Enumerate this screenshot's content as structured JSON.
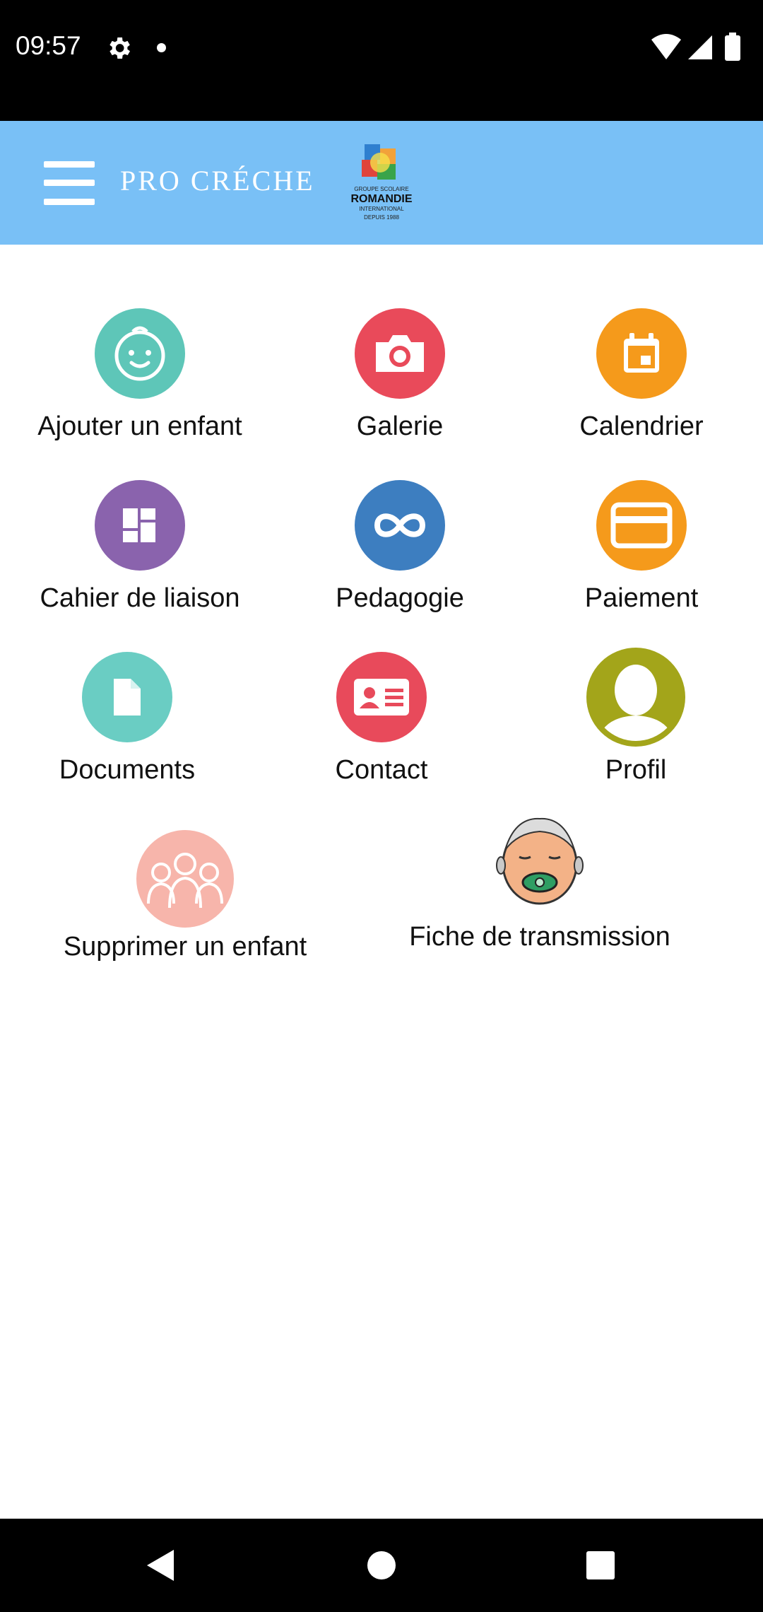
{
  "status_bar": {
    "time": "09:57"
  },
  "app_bar": {
    "title": "PRO CRÉCHE",
    "logo_text": {
      "line1": "GROUPE SCOLAIRE",
      "line2": "ROMANDIE",
      "line3": "INTERNATIONAL",
      "line4": "DEPUIS 1988"
    }
  },
  "menu": {
    "items": [
      {
        "label": "Ajouter un enfant",
        "icon": "baby-face-icon",
        "color": "#5ec6b8"
      },
      {
        "label": "Galerie",
        "icon": "camera-icon",
        "color": "#e94a5a"
      },
      {
        "label": "Calendrier",
        "icon": "calendar-icon",
        "color": "#f59a1b"
      },
      {
        "label": "Cahier de liaison",
        "icon": "dashboard-icon",
        "color": "#8a63ad"
      },
      {
        "label": "Pedagogie",
        "icon": "infinity-icon",
        "color": "#3d7ec0"
      },
      {
        "label": "Paiement",
        "icon": "credit-card-icon",
        "color": "#f59a1b"
      },
      {
        "label": "Documents",
        "icon": "document-icon",
        "color": "#6acdc3"
      },
      {
        "label": "Contact",
        "icon": "id-card-icon",
        "color": "#e84a5b"
      },
      {
        "label": "Profil",
        "icon": "user-silhouette-icon",
        "color": "#a3a51a"
      },
      {
        "label": "Supprimer un enfant",
        "icon": "children-group-icon",
        "color": "#f7b5ab"
      },
      {
        "label": "Fiche de transmission",
        "icon": "baby-pacifier-icon",
        "color": "#f3b287"
      }
    ]
  }
}
